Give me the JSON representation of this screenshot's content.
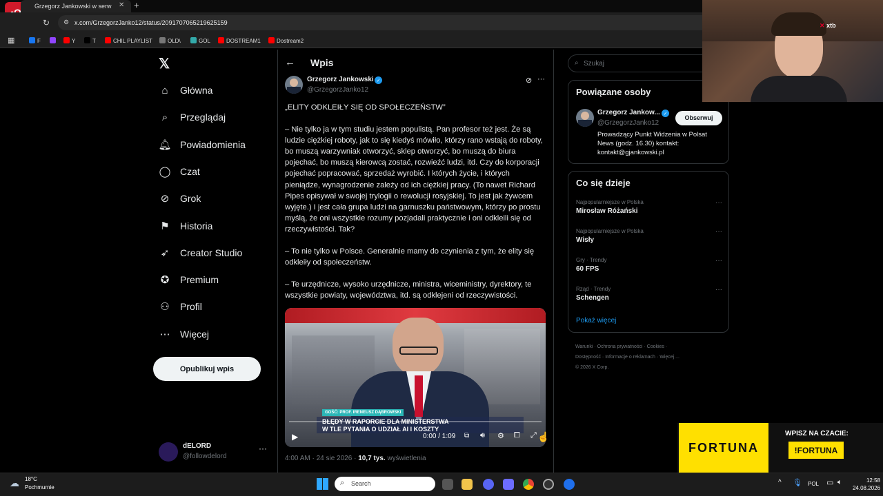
{
  "browser": {
    "tab_title": "Grzegorz Jankowski w serw",
    "url": "x.com/GrzegorzJanko12/status/2091707065219625159",
    "bookmarks": [
      {
        "label": "F",
        "color": "#1877f2"
      },
      {
        "label": "",
        "color": "#9146ff"
      },
      {
        "label": "Y",
        "color": "#ff0000"
      },
      {
        "label": "T",
        "color": "#000000"
      },
      {
        "label": "CHIL PLAYLIST",
        "color": "#ff0000"
      },
      {
        "label": "OLD\\",
        "color": "#777777"
      },
      {
        "label": "GOL",
        "color": "#3aa"
      },
      {
        "label": "DOSTREAM1",
        "color": "#ff0000"
      },
      {
        "label": "Dostream2",
        "color": "#ff0000"
      }
    ]
  },
  "nav": {
    "items": [
      {
        "label": "Główna",
        "icon": "home-icon"
      },
      {
        "label": "Przeglądaj",
        "icon": "search-icon"
      },
      {
        "label": "Powiadomienia",
        "icon": "bell-icon"
      },
      {
        "label": "Czat",
        "icon": "chat-icon"
      },
      {
        "label": "Grok",
        "icon": "grok-icon"
      },
      {
        "label": "Historia",
        "icon": "bookmark-icon"
      },
      {
        "label": "Creator Studio",
        "icon": "rocket-icon"
      },
      {
        "label": "Premium",
        "icon": "verified-icon"
      },
      {
        "label": "Profil",
        "icon": "person-icon"
      },
      {
        "label": "Więcej",
        "icon": "more-circle-icon"
      }
    ],
    "post_button": "Opublikuj wpis",
    "account": {
      "name": "dELORD",
      "handle": "@followdelord"
    }
  },
  "post": {
    "header_title": "Wpis",
    "author_name": "Grzegorz Jankowski",
    "author_handle": "@GrzegorzJanko12",
    "paragraphs": [
      "„ELITY ODKLEIŁY SIĘ OD SPOŁECZEŃSTW”",
      "– Nie tylko ja w tym studiu jestem populistą. Pan profesor też jest. Że są ludzie ciężkiej roboty, jak to się kiedyś mówiło, którzy rano wstają do roboty, bo muszą warzywniak otworzyć, sklep otworzyć, bo muszą do biura pojechać, bo muszą kierowcą zostać, rozwieźć ludzi, itd. Czy do korporacji pojechać popracować, sprzedaż wyrobić. I których życie, i których pieniądze, wynagrodzenie zależy od ich ciężkiej pracy. (To nawet Richard Pipes opisywał w swojej trylogii o rewolucji rosyjskiej. To jest jak żywcem wyjęte.) I jest cała grupa ludzi na garnuszku państwowym, którzy po prostu myślą, że oni wszystkie rozumy pozjadali praktycznie i oni odkleili się od rzeczywistości. Tak?",
      "– To nie tylko w Polsce. Generalnie mamy do czynienia z tym, że elity się odkleiły od społeczeństw.",
      "– Te urzędnicze, wysoko urzędnicze, ministra, wiceministry, dyrektory, te wszystkie powiaty, województwa, itd. są odklejeni od rzeczywistości."
    ],
    "video": {
      "guest_tag": "GOŚĆ: PROF. IRENEUSZ DĄBROWSKI",
      "caption_line1": "BŁĘDY W RAPORCIE DLA MINISTERSTWA",
      "caption_line2": "W TLE PYTANIA O UDZIAŁ AI I KOSZTY",
      "time": "0:00 / 1:09"
    },
    "meta_time": "4:00 AM · 24 sie 2026 ·",
    "views_count": "10,7 tys.",
    "views_label": "wyświetlenia"
  },
  "sidebar": {
    "search_placeholder": "Szukaj",
    "related_title": "Powiązane osoby",
    "related": {
      "name": "Grzegorz Jankow...",
      "handle": "@GrzegorzJanko12",
      "follow": "Obserwuj",
      "bio": "Prowadzący Punkt Widzenia w Polsat News (godz. 16.30) kontakt: kontakt@gjankowski.pl"
    },
    "trends_title": "Co się dzieje",
    "trends": [
      {
        "context": "Najpopularniejsze w Polska",
        "topic": "Mirosław Różański"
      },
      {
        "context": "Najpopularniejsze w Polska",
        "topic": "Wisły"
      },
      {
        "context": "Gry · Trendy",
        "topic": "60 FPS"
      },
      {
        "context": "Rząd · Trendy",
        "topic": "Schengen"
      }
    ],
    "show_more": "Pokaż więcej",
    "footer_links": [
      "Warunki",
      "Ochrona prywatności",
      "Cookies",
      "Dostępność",
      "Informacje o reklamach",
      "Więcej ...",
      "© 2026 X Corp."
    ]
  },
  "stream": {
    "webcam_brand": "xtb",
    "ad_brand": "FORTUNA",
    "ad_prompt": "WPISZ NA CZACIE:",
    "ad_code": "!FORTUNA"
  },
  "taskbar": {
    "weather_temp": "18°C",
    "weather_desc": "Pochmurnie",
    "search": "Search",
    "lang": "POL",
    "time": "12:58",
    "date": "24.08.2026"
  },
  "colors": {
    "accent": "#1d9bf0",
    "background": "#000000",
    "border": "#2f3336",
    "muted": "#71767b",
    "fortuna_yellow": "#ffe000"
  }
}
